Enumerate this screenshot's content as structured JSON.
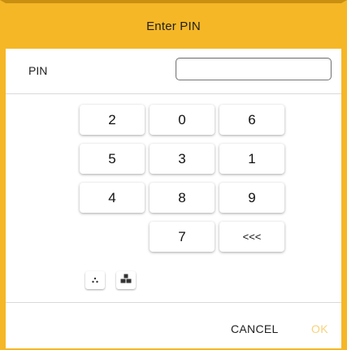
{
  "dialog": {
    "title": "Enter PIN",
    "pin_label": "PIN",
    "pin_value": "",
    "pin_placeholder": ""
  },
  "keypad": {
    "keys": [
      "2",
      "0",
      "6",
      "5",
      "3",
      "1",
      "4",
      "8",
      "9",
      "7",
      "<<<"
    ],
    "backspace_label": "<<<"
  },
  "keyboard_toggles": [
    {
      "icon": "small-dots-icon"
    },
    {
      "icon": "block-stack-icon"
    }
  ],
  "footer": {
    "cancel_label": "CANCEL",
    "ok_label": "OK"
  },
  "colors": {
    "accent": "#f5b726",
    "ok_disabled": "#f7d27c"
  }
}
